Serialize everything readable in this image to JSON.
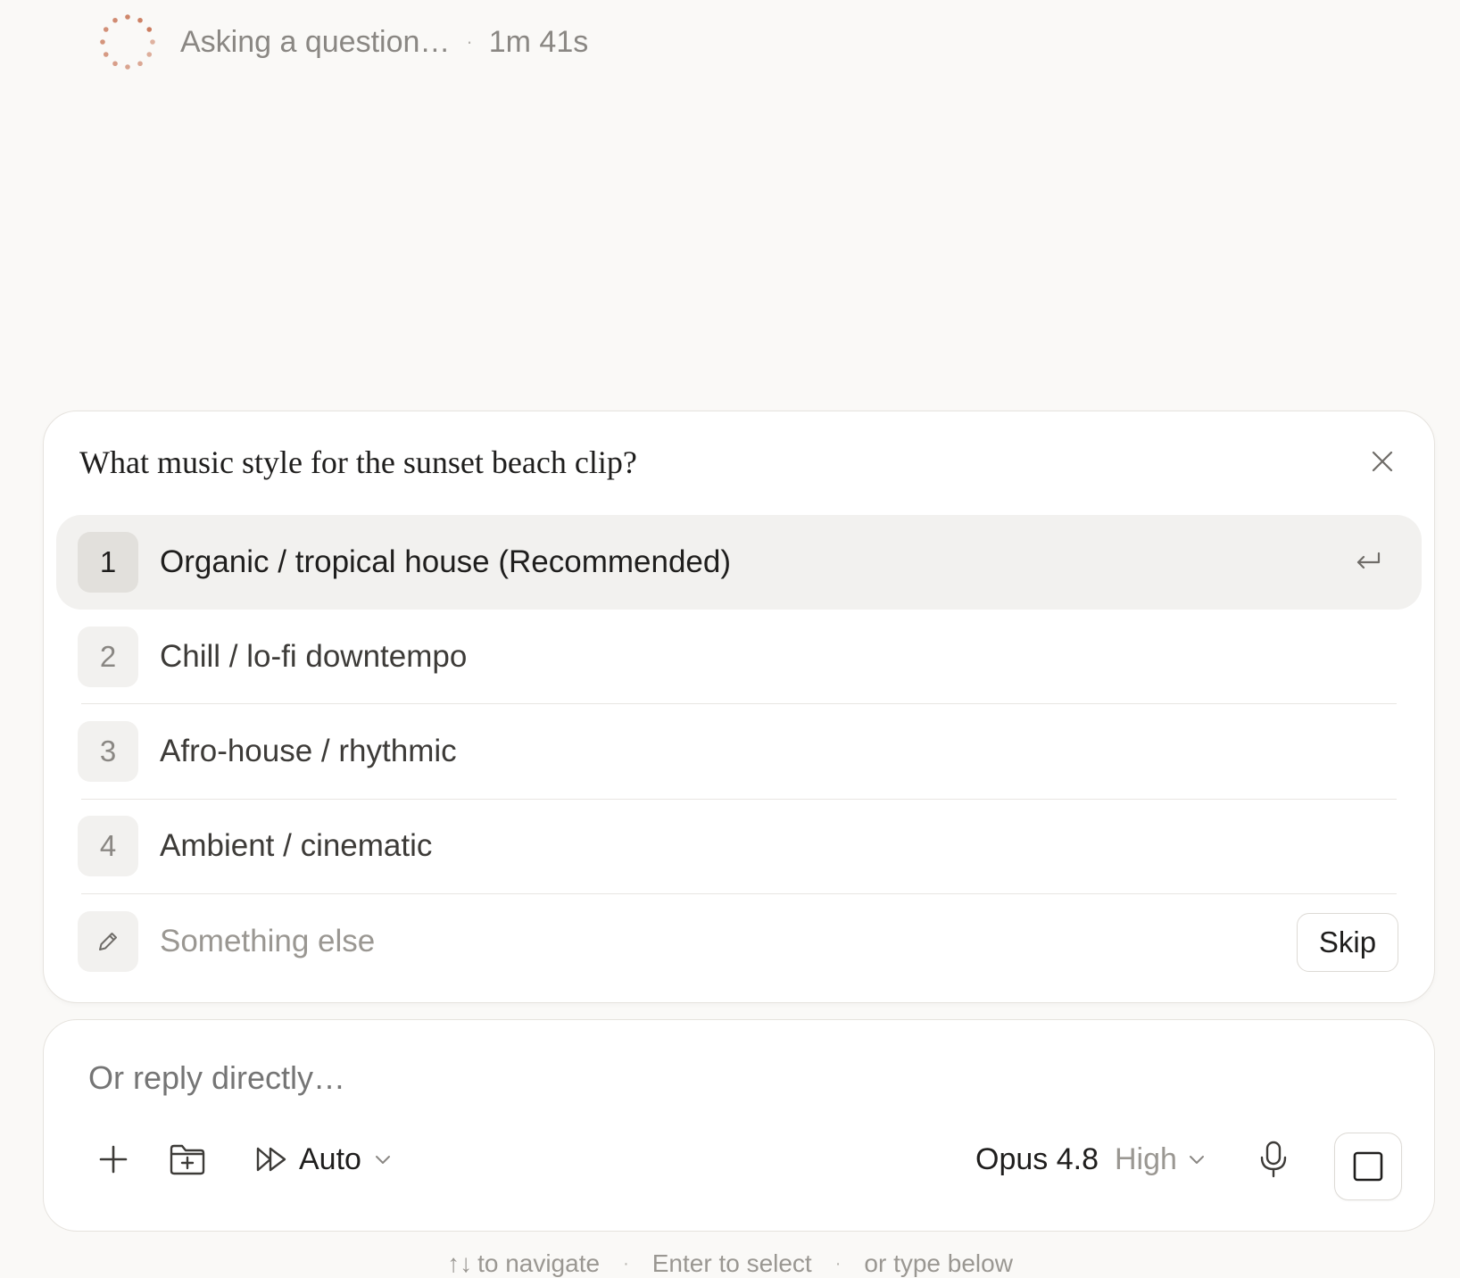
{
  "status": {
    "text": "Asking a question…",
    "separator": "·",
    "elapsed": "1m 41s",
    "spinner_color": "#c9785a"
  },
  "question": {
    "title": "What music style for the sunset beach clip?",
    "options": [
      {
        "number": "1",
        "label": "Organic / tropical house (Recommended)",
        "selected": true
      },
      {
        "number": "2",
        "label": "Chill / lo-fi downtempo",
        "selected": false
      },
      {
        "number": "3",
        "label": "Afro-house / rhythmic",
        "selected": false
      },
      {
        "number": "4",
        "label": "Ambient / cinematic",
        "selected": false
      }
    ],
    "custom_placeholder": "Something else",
    "skip_label": "Skip"
  },
  "composer": {
    "placeholder": "Or reply directly…",
    "mode_label": "Auto",
    "model_name": "Opus 4.8",
    "effort_label": "High"
  },
  "hints": {
    "arrows": "↑↓",
    "navigate": "to navigate",
    "select": "Enter to select",
    "type": "or type below",
    "separator": "·"
  }
}
